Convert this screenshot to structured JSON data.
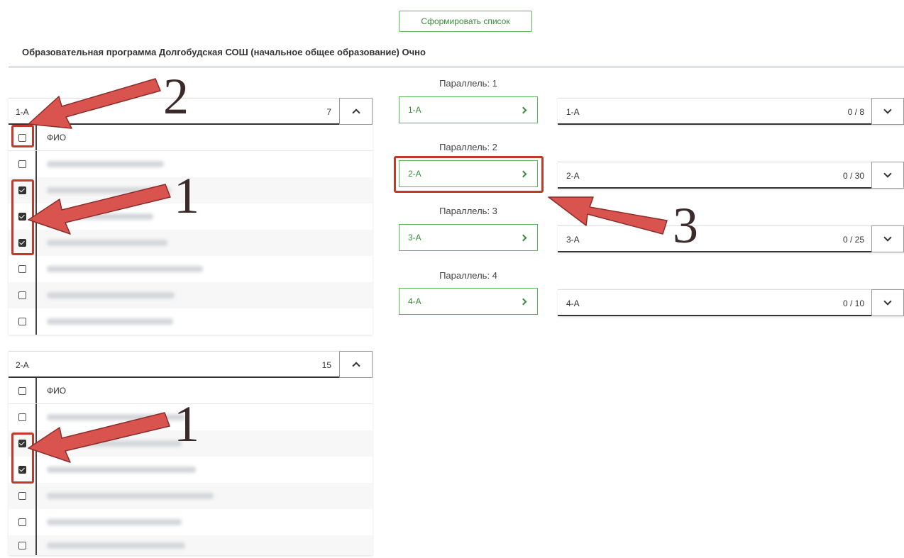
{
  "toolbar": {
    "generate_label": "Сформировать список"
  },
  "program_title": "Образовательная программа Долгобудская СОШ (начальное общее образование) Очно",
  "fio_label": "ФИО",
  "class_panels": [
    {
      "name": "1-А",
      "count": "7",
      "rows": [
        false,
        true,
        true,
        true,
        false,
        false,
        false
      ]
    },
    {
      "name": "2-А",
      "count": "15",
      "rows": [
        false,
        true,
        true,
        false,
        false,
        false
      ]
    }
  ],
  "parallels": [
    {
      "label": "Параллель: 1",
      "button": "1-А"
    },
    {
      "label": "Параллель: 2",
      "button": "2-А"
    },
    {
      "label": "Параллель: 3",
      "button": "3-А"
    },
    {
      "label": "Параллель: 4",
      "button": "4-А"
    }
  ],
  "targets": [
    {
      "name": "1-А",
      "count": "0 / 8"
    },
    {
      "name": "2-А",
      "count": "0 / 30"
    },
    {
      "name": "3-А",
      "count": "0 / 25"
    },
    {
      "name": "4-А",
      "count": "0 / 10"
    }
  ],
  "annotations": {
    "n1": "1",
    "n2": "2",
    "n3": "3",
    "color": "#d9534f"
  }
}
